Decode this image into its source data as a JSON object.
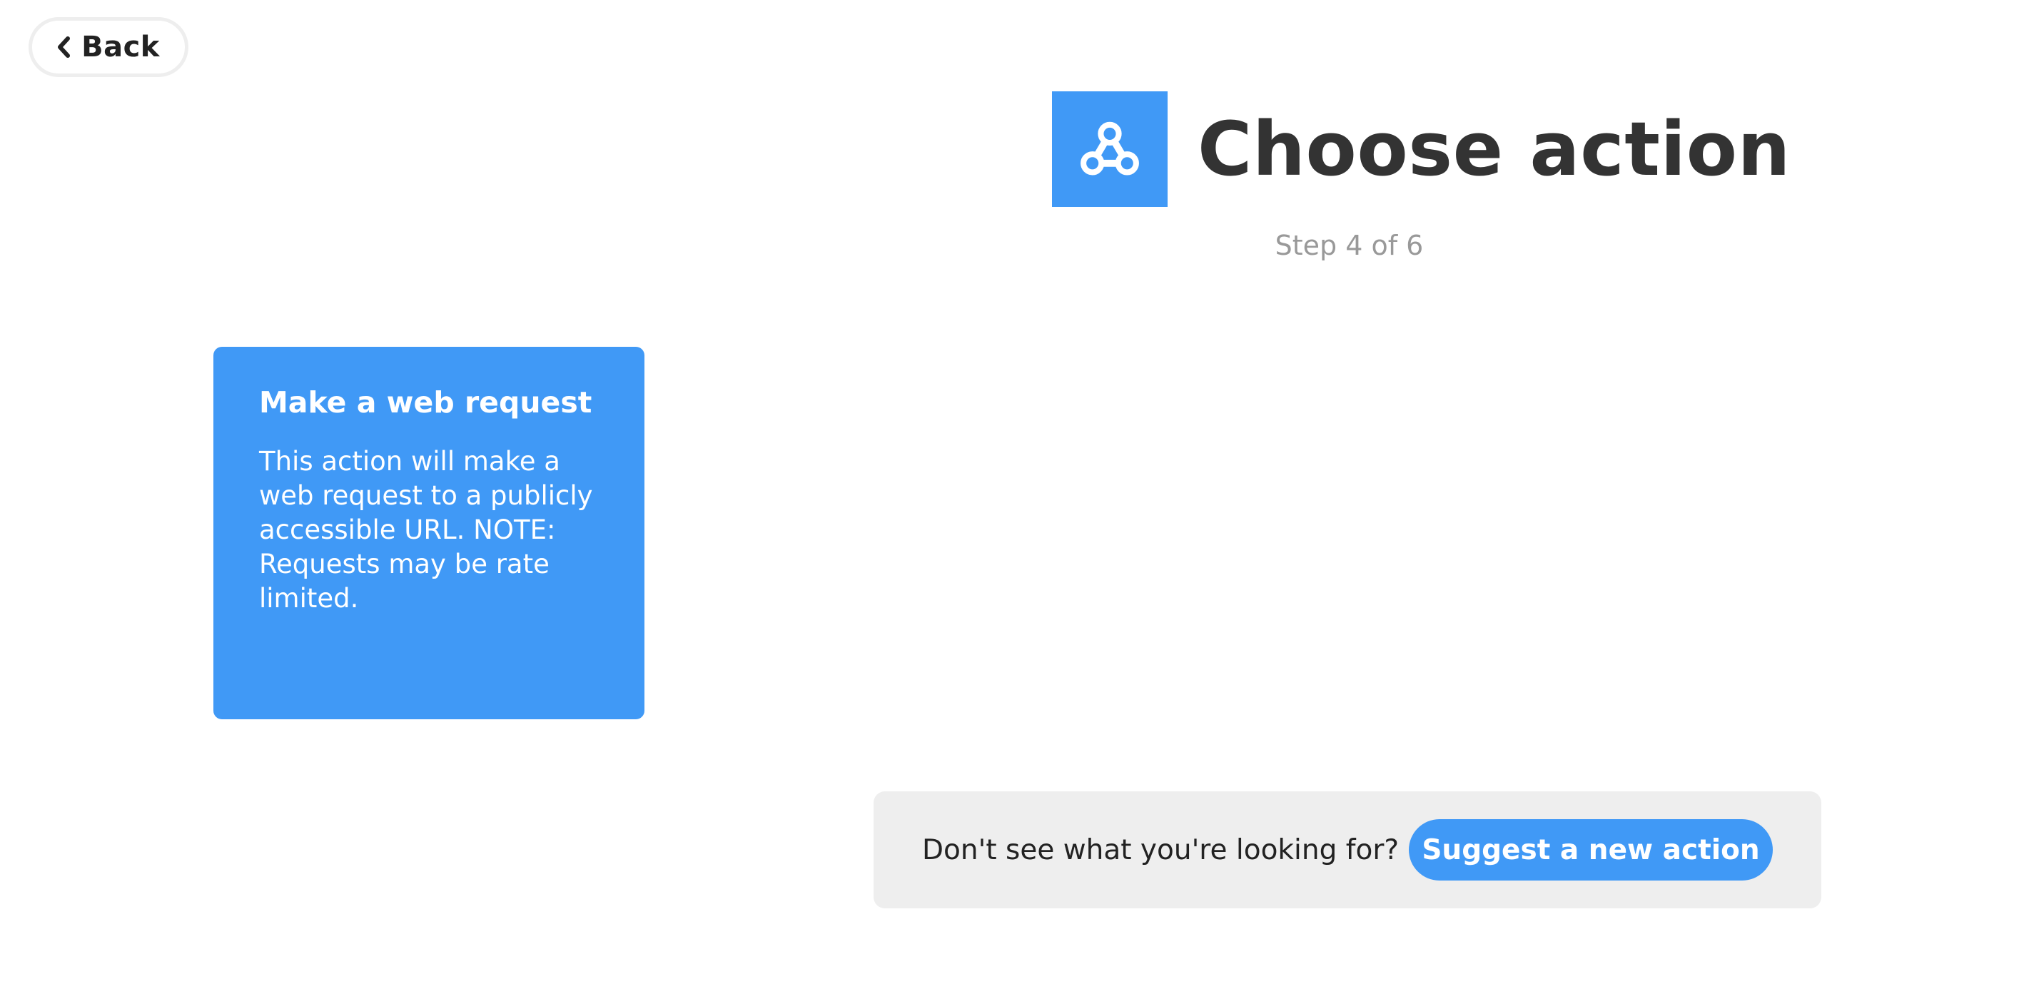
{
  "nav": {
    "back_label": "Back",
    "back_icon": "chevron-left-icon"
  },
  "header": {
    "title": "Choose action",
    "step": "Step 4 of 6",
    "service_icon": "webhook-icon"
  },
  "actions": [
    {
      "title": "Make a web request",
      "description": "This action will make a web request to a publicly accessible URL. NOTE: Requests may be rate limited."
    }
  ],
  "suggest": {
    "prompt": "Don't see what you're looking for?",
    "button_label": "Suggest a new action"
  },
  "colors": {
    "accent": "#4099f6",
    "title_text": "#333333",
    "muted_text": "#999999",
    "panel_bg": "#eeeeee",
    "back_border": "#eeeeee"
  }
}
